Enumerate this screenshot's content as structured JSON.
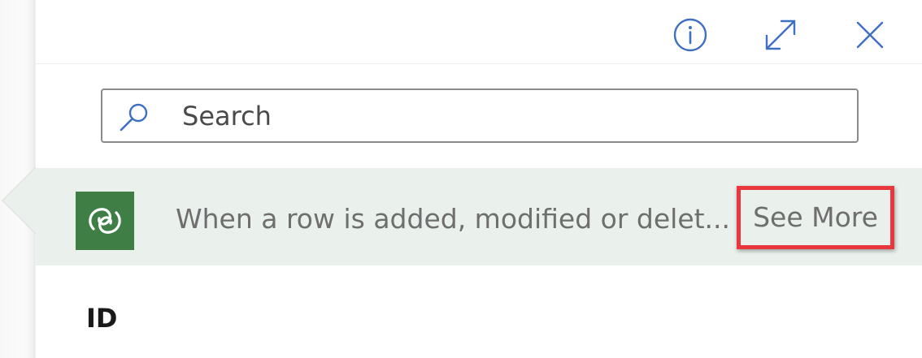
{
  "header": {
    "info_icon": "info-icon",
    "expand_icon": "expand-icon",
    "close_icon": "close-icon"
  },
  "search": {
    "placeholder": "Search",
    "value": "",
    "icon": "search-icon"
  },
  "trigger": {
    "connector_icon": "dataverse-logo",
    "title": "When a row is added, modified or delet...",
    "see_more_label": "See More"
  },
  "fields": {
    "id_label": "ID"
  },
  "colors": {
    "accent": "#3f6fc0",
    "trigger_background": "#eaf1ec",
    "connector_brand": "#3f7f46",
    "highlight_border": "#e8383d"
  }
}
